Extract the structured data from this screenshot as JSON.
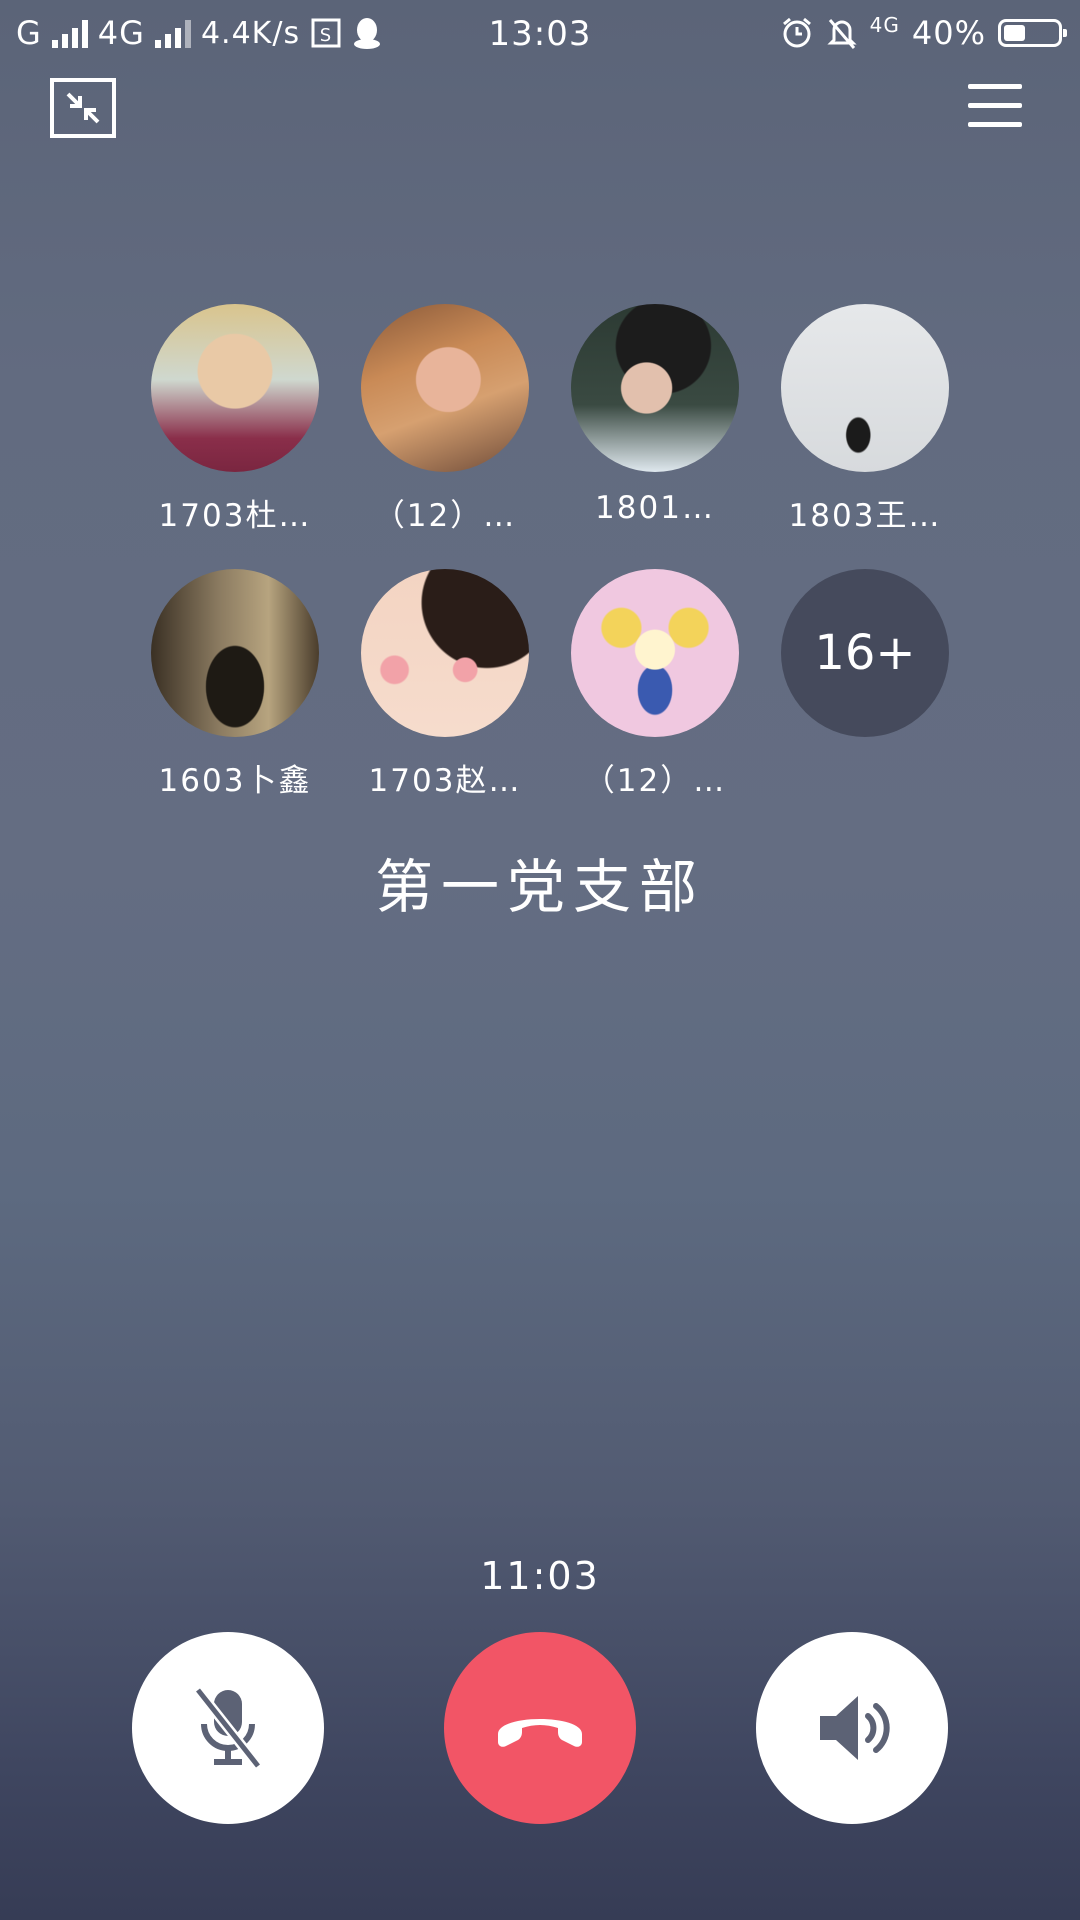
{
  "status_bar": {
    "carrier_left": "G",
    "network_2": "4G",
    "net_speed": "4.4K/s",
    "time": "13:03",
    "network_right": "4G",
    "battery": "40%",
    "battery_level": 0.4
  },
  "header": {
    "minimize_icon": "minimize-arrows-icon",
    "menu_icon": "hamburger-menu-icon"
  },
  "members": [
    {
      "name": "1703杜…"
    },
    {
      "name": "（12）…"
    },
    {
      "name": "1801…"
    },
    {
      "name": "1803王…"
    },
    {
      "name": "1603卜鑫"
    },
    {
      "name": "1703赵…"
    },
    {
      "name": "（12）…"
    }
  ],
  "more_count": "16+",
  "group_name": "第一党支部",
  "call_timer": "11:03",
  "controls": {
    "mute_icon": "microphone-muted-icon",
    "hangup_icon": "phone-hangup-icon",
    "speaker_icon": "speaker-icon",
    "hangup_color": "#f25566"
  }
}
